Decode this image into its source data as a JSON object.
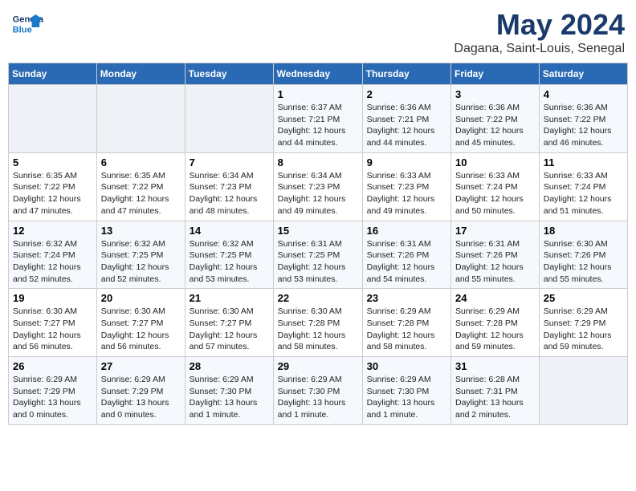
{
  "logo": {
    "general": "General",
    "blue": "Blue"
  },
  "title": "May 2024",
  "location": "Dagana, Saint-Louis, Senegal",
  "days_header": [
    "Sunday",
    "Monday",
    "Tuesday",
    "Wednesday",
    "Thursday",
    "Friday",
    "Saturday"
  ],
  "weeks": [
    [
      {
        "day": "",
        "info": ""
      },
      {
        "day": "",
        "info": ""
      },
      {
        "day": "",
        "info": ""
      },
      {
        "day": "1",
        "info": "Sunrise: 6:37 AM\nSunset: 7:21 PM\nDaylight: 12 hours\nand 44 minutes."
      },
      {
        "day": "2",
        "info": "Sunrise: 6:36 AM\nSunset: 7:21 PM\nDaylight: 12 hours\nand 44 minutes."
      },
      {
        "day": "3",
        "info": "Sunrise: 6:36 AM\nSunset: 7:22 PM\nDaylight: 12 hours\nand 45 minutes."
      },
      {
        "day": "4",
        "info": "Sunrise: 6:36 AM\nSunset: 7:22 PM\nDaylight: 12 hours\nand 46 minutes."
      }
    ],
    [
      {
        "day": "5",
        "info": "Sunrise: 6:35 AM\nSunset: 7:22 PM\nDaylight: 12 hours\nand 47 minutes."
      },
      {
        "day": "6",
        "info": "Sunrise: 6:35 AM\nSunset: 7:22 PM\nDaylight: 12 hours\nand 47 minutes."
      },
      {
        "day": "7",
        "info": "Sunrise: 6:34 AM\nSunset: 7:23 PM\nDaylight: 12 hours\nand 48 minutes."
      },
      {
        "day": "8",
        "info": "Sunrise: 6:34 AM\nSunset: 7:23 PM\nDaylight: 12 hours\nand 49 minutes."
      },
      {
        "day": "9",
        "info": "Sunrise: 6:33 AM\nSunset: 7:23 PM\nDaylight: 12 hours\nand 49 minutes."
      },
      {
        "day": "10",
        "info": "Sunrise: 6:33 AM\nSunset: 7:24 PM\nDaylight: 12 hours\nand 50 minutes."
      },
      {
        "day": "11",
        "info": "Sunrise: 6:33 AM\nSunset: 7:24 PM\nDaylight: 12 hours\nand 51 minutes."
      }
    ],
    [
      {
        "day": "12",
        "info": "Sunrise: 6:32 AM\nSunset: 7:24 PM\nDaylight: 12 hours\nand 52 minutes."
      },
      {
        "day": "13",
        "info": "Sunrise: 6:32 AM\nSunset: 7:25 PM\nDaylight: 12 hours\nand 52 minutes."
      },
      {
        "day": "14",
        "info": "Sunrise: 6:32 AM\nSunset: 7:25 PM\nDaylight: 12 hours\nand 53 minutes."
      },
      {
        "day": "15",
        "info": "Sunrise: 6:31 AM\nSunset: 7:25 PM\nDaylight: 12 hours\nand 53 minutes."
      },
      {
        "day": "16",
        "info": "Sunrise: 6:31 AM\nSunset: 7:26 PM\nDaylight: 12 hours\nand 54 minutes."
      },
      {
        "day": "17",
        "info": "Sunrise: 6:31 AM\nSunset: 7:26 PM\nDaylight: 12 hours\nand 55 minutes."
      },
      {
        "day": "18",
        "info": "Sunrise: 6:30 AM\nSunset: 7:26 PM\nDaylight: 12 hours\nand 55 minutes."
      }
    ],
    [
      {
        "day": "19",
        "info": "Sunrise: 6:30 AM\nSunset: 7:27 PM\nDaylight: 12 hours\nand 56 minutes."
      },
      {
        "day": "20",
        "info": "Sunrise: 6:30 AM\nSunset: 7:27 PM\nDaylight: 12 hours\nand 56 minutes."
      },
      {
        "day": "21",
        "info": "Sunrise: 6:30 AM\nSunset: 7:27 PM\nDaylight: 12 hours\nand 57 minutes."
      },
      {
        "day": "22",
        "info": "Sunrise: 6:30 AM\nSunset: 7:28 PM\nDaylight: 12 hours\nand 58 minutes."
      },
      {
        "day": "23",
        "info": "Sunrise: 6:29 AM\nSunset: 7:28 PM\nDaylight: 12 hours\nand 58 minutes."
      },
      {
        "day": "24",
        "info": "Sunrise: 6:29 AM\nSunset: 7:28 PM\nDaylight: 12 hours\nand 59 minutes."
      },
      {
        "day": "25",
        "info": "Sunrise: 6:29 AM\nSunset: 7:29 PM\nDaylight: 12 hours\nand 59 minutes."
      }
    ],
    [
      {
        "day": "26",
        "info": "Sunrise: 6:29 AM\nSunset: 7:29 PM\nDaylight: 13 hours\nand 0 minutes."
      },
      {
        "day": "27",
        "info": "Sunrise: 6:29 AM\nSunset: 7:29 PM\nDaylight: 13 hours\nand 0 minutes."
      },
      {
        "day": "28",
        "info": "Sunrise: 6:29 AM\nSunset: 7:30 PM\nDaylight: 13 hours\nand 1 minute."
      },
      {
        "day": "29",
        "info": "Sunrise: 6:29 AM\nSunset: 7:30 PM\nDaylight: 13 hours\nand 1 minute."
      },
      {
        "day": "30",
        "info": "Sunrise: 6:29 AM\nSunset: 7:30 PM\nDaylight: 13 hours\nand 1 minute."
      },
      {
        "day": "31",
        "info": "Sunrise: 6:28 AM\nSunset: 7:31 PM\nDaylight: 13 hours\nand 2 minutes."
      },
      {
        "day": "",
        "info": ""
      }
    ]
  ]
}
